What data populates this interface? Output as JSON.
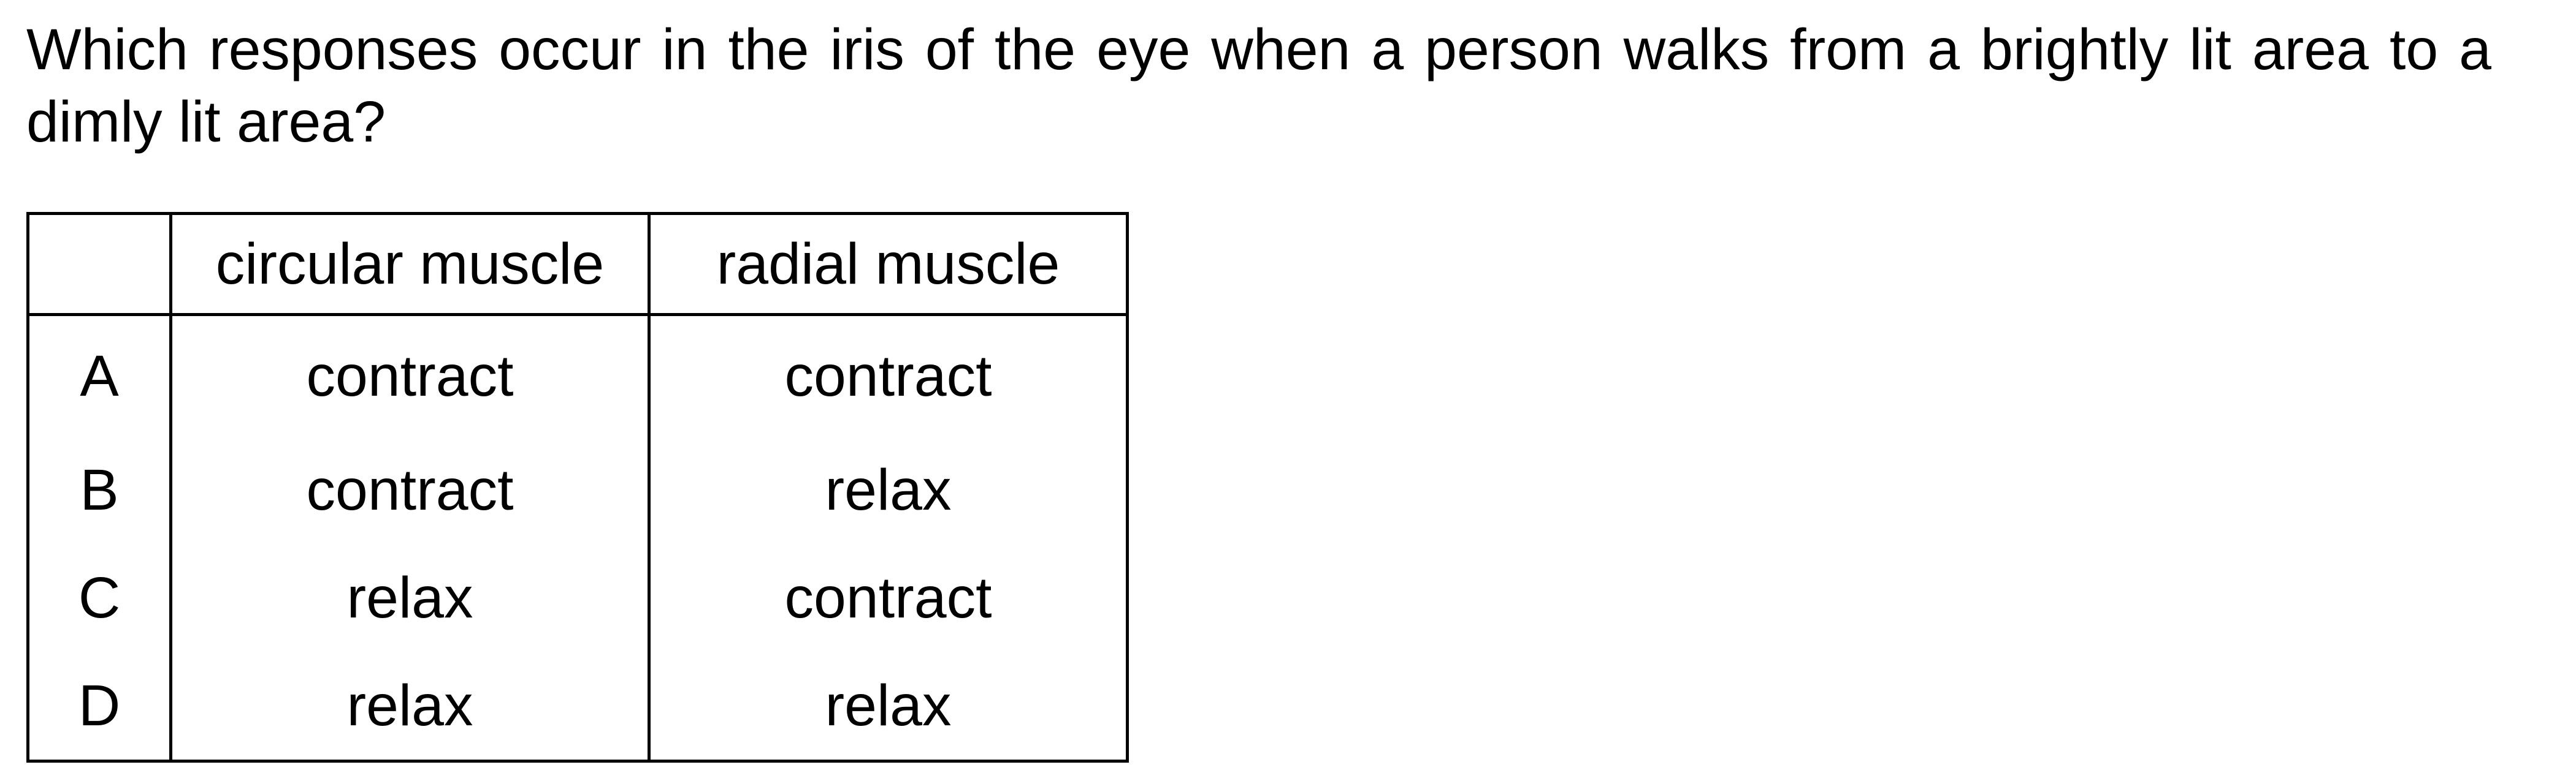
{
  "question": {
    "text": "Which responses occur in the iris of the eye when a person walks from a brightly lit area to a dimly lit area?"
  },
  "table": {
    "headers": [
      "",
      "circular muscle",
      "radial muscle"
    ],
    "rows": [
      {
        "key": "A",
        "circular": "contract",
        "radial": "contract"
      },
      {
        "key": "B",
        "circular": "contract",
        "radial": "relax"
      },
      {
        "key": "C",
        "circular": "relax",
        "radial": "contract"
      },
      {
        "key": "D",
        "circular": "relax",
        "radial": "relax"
      }
    ]
  }
}
